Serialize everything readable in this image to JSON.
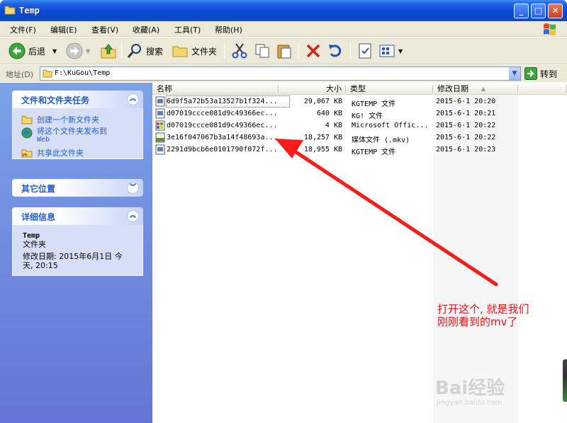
{
  "window": {
    "title": "Temp"
  },
  "menu": [
    {
      "label": "文件(F)"
    },
    {
      "label": "编辑(E)"
    },
    {
      "label": "查看(V)"
    },
    {
      "label": "收藏(A)"
    },
    {
      "label": "工具(T)"
    },
    {
      "label": "帮助(H)"
    }
  ],
  "toolbar": {
    "back": "后退",
    "search": "搜索",
    "folders": "文件夹"
  },
  "address": {
    "label": "地址(D)",
    "path": "F:\\KuGou\\Temp",
    "go": "转到"
  },
  "tasks_panel": {
    "title": "文件和文件夹任务",
    "items": [
      {
        "label": "创建一个新文件夹"
      },
      {
        "label": "将这个文件夹发布到",
        "label2": "Web"
      },
      {
        "label": "共享此文件夹"
      }
    ]
  },
  "other_panel": {
    "title": "其它位置"
  },
  "details_panel": {
    "title": "详细信息",
    "name": "Temp",
    "type": "文件夹",
    "modified_1": "修改日期: 2015年6月1日 今",
    "modified_2": "天, 20:15"
  },
  "columns": {
    "name": "名称",
    "size": "大小",
    "type": "类型",
    "date": "修改日期"
  },
  "files": [
    {
      "name": "6d9f5a72b53a13527b1f324...",
      "size": "29,067 KB",
      "type": "KGTEMP 文件",
      "date": "2015-6-1 20:20"
    },
    {
      "name": "d07019ccce081d9c49366ec...",
      "size": "640 KB",
      "type": "KG! 文件",
      "date": "2015-6-1 20:21"
    },
    {
      "name": "d07019ccce081d9c49366ec...",
      "size": "4 KB",
      "type": "Microsoft Offic...",
      "date": "2015-6-1 20:22"
    },
    {
      "name": "3e16f047067b3a14f48693a...",
      "size": "18,257 KB",
      "type": "媒体文件 (.mkv)",
      "date": "2015-6-1 20:22"
    },
    {
      "name": "2291d9bcb6e0101790f072f...",
      "size": "18,955 KB",
      "type": "KGTEMP 文件",
      "date": "2015-6-1 20:23"
    }
  ],
  "annotation": {
    "line1": "打开这个, 就是我们",
    "line2": "刚刚看到的mv了"
  },
  "watermark": {
    "logo": "Bai经验",
    "sub": "jingyan.baidu.com"
  }
}
